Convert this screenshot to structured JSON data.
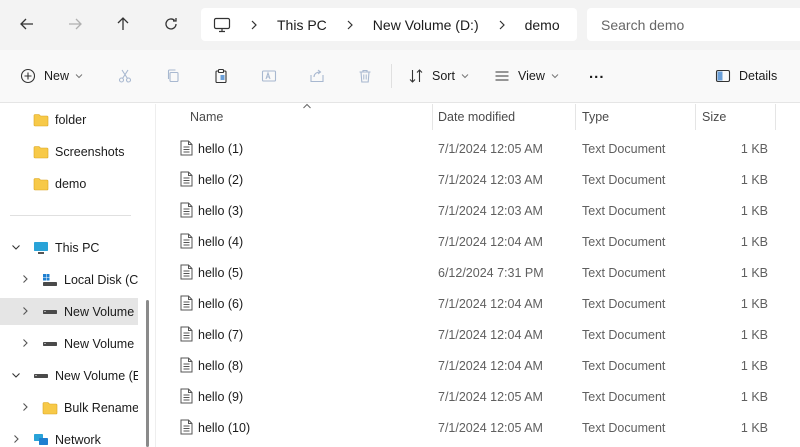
{
  "nav": {
    "back": "back-arrow-icon",
    "forward": "forward-arrow-icon",
    "up": "up-arrow-icon",
    "refresh": "refresh-icon"
  },
  "breadcrumb": [
    "This PC",
    "New Volume (D:)",
    "demo"
  ],
  "search": {
    "placeholder": "Search demo"
  },
  "toolbar": {
    "new_label": "New",
    "sort_label": "Sort",
    "view_label": "View",
    "details_label": "Details",
    "more_label": "..."
  },
  "sidebar": {
    "quick": [
      {
        "label": "folder",
        "icon": "folder-icon"
      },
      {
        "label": "Screenshots",
        "icon": "folder-icon"
      },
      {
        "label": "demo",
        "icon": "folder-icon"
      }
    ],
    "tree": [
      {
        "label": "This PC",
        "icon": "pc-icon",
        "expanded": true
      },
      {
        "label": "Local Disk (C:)",
        "icon": "windows-drive-icon"
      },
      {
        "label": "New Volume (D:)",
        "icon": "drive-icon",
        "selected": true
      },
      {
        "label": "New Volume (D:)",
        "icon": "drive-icon"
      },
      {
        "label": "New Volume (E:)",
        "icon": "drive-icon",
        "expanded": true
      },
      {
        "label": "Bulk Rename Utility",
        "icon": "folder-icon"
      },
      {
        "label": "Network",
        "icon": "network-icon"
      }
    ]
  },
  "columns": {
    "name": "Name",
    "date": "Date modified",
    "type": "Type",
    "size": "Size"
  },
  "files": [
    {
      "name": "hello (1)",
      "date": "7/1/2024 12:05 AM",
      "type": "Text Document",
      "size": "1 KB"
    },
    {
      "name": "hello (2)",
      "date": "7/1/2024 12:03 AM",
      "type": "Text Document",
      "size": "1 KB"
    },
    {
      "name": "hello (3)",
      "date": "7/1/2024 12:03 AM",
      "type": "Text Document",
      "size": "1 KB"
    },
    {
      "name": "hello (4)",
      "date": "7/1/2024 12:04 AM",
      "type": "Text Document",
      "size": "1 KB"
    },
    {
      "name": "hello (5)",
      "date": "6/12/2024 7:31 PM",
      "type": "Text Document",
      "size": "1 KB"
    },
    {
      "name": "hello (6)",
      "date": "7/1/2024 12:04 AM",
      "type": "Text Document",
      "size": "1 KB"
    },
    {
      "name": "hello (7)",
      "date": "7/1/2024 12:04 AM",
      "type": "Text Document",
      "size": "1 KB"
    },
    {
      "name": "hello (8)",
      "date": "7/1/2024 12:04 AM",
      "type": "Text Document",
      "size": "1 KB"
    },
    {
      "name": "hello (9)",
      "date": "7/1/2024 12:05 AM",
      "type": "Text Document",
      "size": "1 KB"
    },
    {
      "name": "hello (10)",
      "date": "7/1/2024 12:05 AM",
      "type": "Text Document",
      "size": "1 KB"
    }
  ],
  "colors": {
    "folder": "#f7c948",
    "accent": "#0067c0",
    "selected": "#e5e5e5"
  }
}
